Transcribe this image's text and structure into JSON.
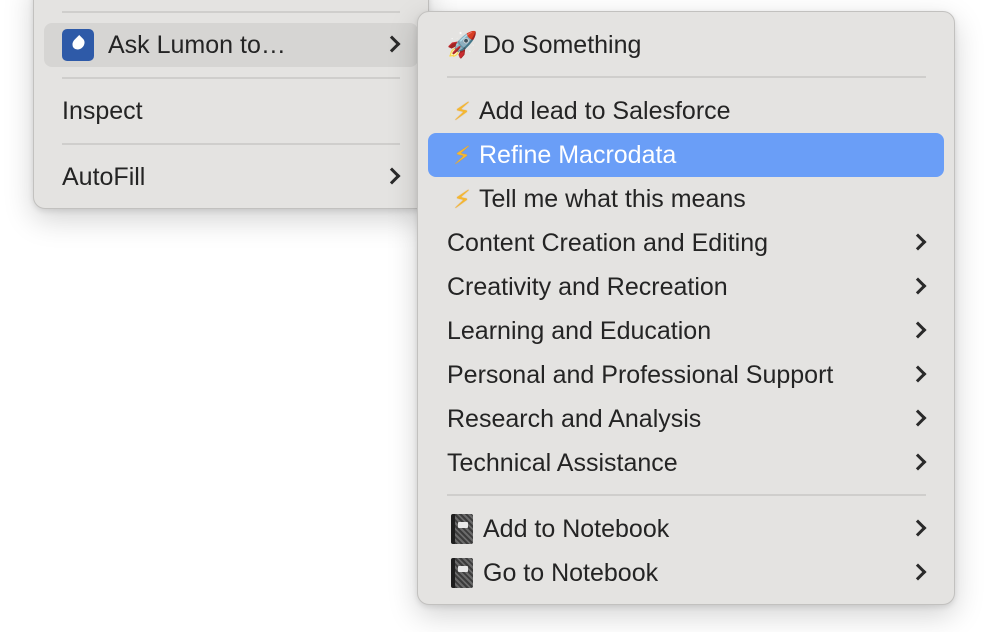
{
  "main_menu": {
    "items": [
      {
        "label": "Ask Lumon to…",
        "icon": "lumon-drop-icon",
        "has_submenu": true,
        "state": "open"
      },
      {
        "label": "Inspect",
        "has_submenu": false
      },
      {
        "label": "AutoFill",
        "has_submenu": true
      }
    ]
  },
  "submenu": {
    "items": [
      {
        "label": "Do Something",
        "icon": "rocket-icon",
        "glyph": "🚀",
        "has_submenu": false
      },
      {
        "label": "Add lead to Salesforce",
        "icon": "lightning-icon",
        "glyph": "⚡",
        "has_submenu": false
      },
      {
        "label": "Refine Macrodata",
        "icon": "lightning-icon",
        "glyph": "⚡",
        "has_submenu": false,
        "state": "highlighted"
      },
      {
        "label": "Tell me what this means",
        "icon": "lightning-icon",
        "glyph": "⚡",
        "has_submenu": false
      },
      {
        "label": "Content Creation and Editing",
        "has_submenu": true
      },
      {
        "label": "Creativity and Recreation",
        "has_submenu": true
      },
      {
        "label": "Learning and Education",
        "has_submenu": true
      },
      {
        "label": "Personal and Professional Support",
        "has_submenu": true
      },
      {
        "label": "Research and Analysis",
        "has_submenu": true
      },
      {
        "label": "Technical Assistance",
        "has_submenu": true
      },
      {
        "label": "Add to Notebook",
        "icon": "notebook-icon",
        "has_submenu": true
      },
      {
        "label": "Go to Notebook",
        "icon": "notebook-icon",
        "has_submenu": true
      }
    ]
  },
  "colors": {
    "menu_background": "#e4e3e1",
    "highlight": "#6a9ef7",
    "hover": "#d6d5d3",
    "lumon_icon": "#2e5aa8",
    "text": "#242424"
  }
}
